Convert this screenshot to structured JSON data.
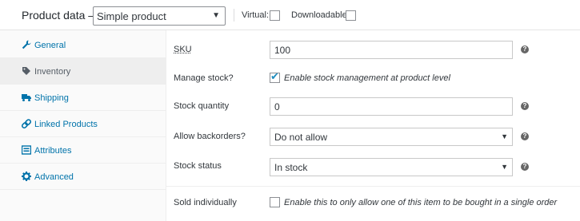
{
  "header": {
    "title": "Product data —",
    "product_type": "Simple product",
    "virtual_label": "Virtual:",
    "downloadable_label": "Downloadable:"
  },
  "sidebar": {
    "items": [
      {
        "label": "General",
        "icon": "wrench-icon"
      },
      {
        "label": "Inventory",
        "icon": "tag-icon",
        "active": true
      },
      {
        "label": "Shipping",
        "icon": "truck-icon"
      },
      {
        "label": "Linked Products",
        "icon": "link-icon"
      },
      {
        "label": "Attributes",
        "icon": "list-icon"
      },
      {
        "label": "Advanced",
        "icon": "gear-icon"
      }
    ]
  },
  "form": {
    "sku_label": "SKU",
    "sku_value": "100",
    "manage_stock_label": "Manage stock?",
    "manage_stock_desc": "Enable stock management at product level",
    "manage_stock_checked": true,
    "stock_qty_label": "Stock quantity",
    "stock_qty_value": "0",
    "backorders_label": "Allow backorders?",
    "backorders_value": "Do not allow",
    "stock_status_label": "Stock status",
    "stock_status_value": "In stock",
    "sold_individually_label": "Sold individually",
    "sold_individually_desc": "Enable this to only allow one of this item to be bought in a single order",
    "help_glyph": "?"
  },
  "colors": {
    "link": "#0073aa",
    "active_tab_bg": "#eeeeee",
    "sidebar_bg": "#fafafa",
    "check": "#1e8cbe"
  }
}
